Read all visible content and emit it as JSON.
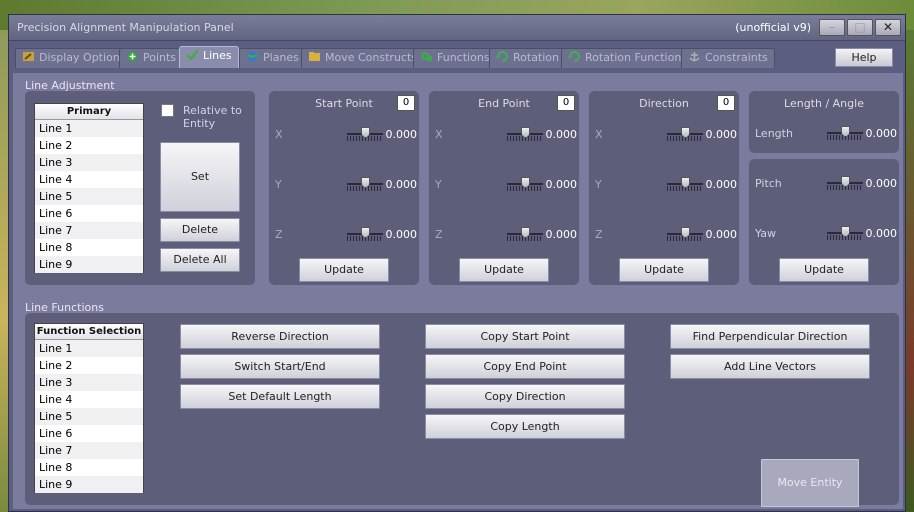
{
  "window": {
    "title": "Precision Alignment Manipulation Panel",
    "version": "(unofficial v9)",
    "minimize": "–",
    "maximize": "□",
    "close": "✕"
  },
  "tabs": [
    {
      "label": "Display Options",
      "icon": "wrench-icon",
      "color": "#c8a040"
    },
    {
      "label": "Points",
      "icon": "plus-circle-icon",
      "color": "#3aa040"
    },
    {
      "label": "Lines",
      "icon": "checkmark-icon",
      "color": "#3ab040",
      "active": true
    },
    {
      "label": "Planes",
      "icon": "globe-icon",
      "color": "#3a7ac8"
    },
    {
      "label": "Move Constructs",
      "icon": "folder-icon",
      "color": "#d8b040"
    },
    {
      "label": "Functions",
      "icon": "gears-icon",
      "color": "#40a850"
    },
    {
      "label": "Rotation",
      "icon": "rotate-icon",
      "color": "#40b050"
    },
    {
      "label": "Rotation Functions",
      "icon": "rotate-icon",
      "color": "#40b050"
    },
    {
      "label": "Constraints",
      "icon": "anchor-icon",
      "color": "#b0b0b8"
    }
  ],
  "help_label": "Help",
  "line_adjustment": {
    "group_label": "Line Adjustment",
    "list_header": "Primary",
    "list_items": [
      "Line 1",
      "Line 2",
      "Line 3",
      "Line 4",
      "Line 5",
      "Line 6",
      "Line 7",
      "Line 8",
      "Line 9"
    ],
    "relative_label_1": "Relative to",
    "relative_label_2": "Entity",
    "set_label": "Set",
    "delete_label": "Delete",
    "delete_all_label": "Delete All",
    "start_point": {
      "title": "Start Point",
      "counter": "0",
      "x": "0.000",
      "y": "0.000",
      "z": "0.000",
      "update": "Update"
    },
    "end_point": {
      "title": "End Point",
      "counter": "0",
      "x": "0.000",
      "y": "0.000",
      "z": "0.000",
      "update": "Update"
    },
    "direction": {
      "title": "Direction",
      "counter": "0",
      "x": "0.000",
      "y": "0.000",
      "z": "0.000",
      "update": "Update"
    },
    "length_angle": {
      "title": "Length / Angle",
      "length_label": "Length",
      "length": "0.000",
      "pitch_label": "Pitch",
      "pitch": "0.000",
      "yaw_label": "Yaw",
      "yaw": "0.000",
      "update": "Update"
    },
    "axis_x": "X",
    "axis_y": "Y",
    "axis_z": "Z"
  },
  "line_functions": {
    "group_label": "Line Functions",
    "list_header": "Function Selection",
    "list_items": [
      "Line 1",
      "Line 2",
      "Line 3",
      "Line 4",
      "Line 5",
      "Line 6",
      "Line 7",
      "Line 8",
      "Line 9"
    ],
    "reverse_direction": "Reverse Direction",
    "switch_start_end": "Switch Start/End",
    "set_default_length": "Set Default Length",
    "copy_start_point": "Copy Start Point",
    "copy_end_point": "Copy End Point",
    "copy_direction": "Copy Direction",
    "copy_length": "Copy Length",
    "find_perpendicular": "Find Perpendicular Direction",
    "add_line_vectors": "Add Line Vectors",
    "move_entity": "Move Entity"
  }
}
